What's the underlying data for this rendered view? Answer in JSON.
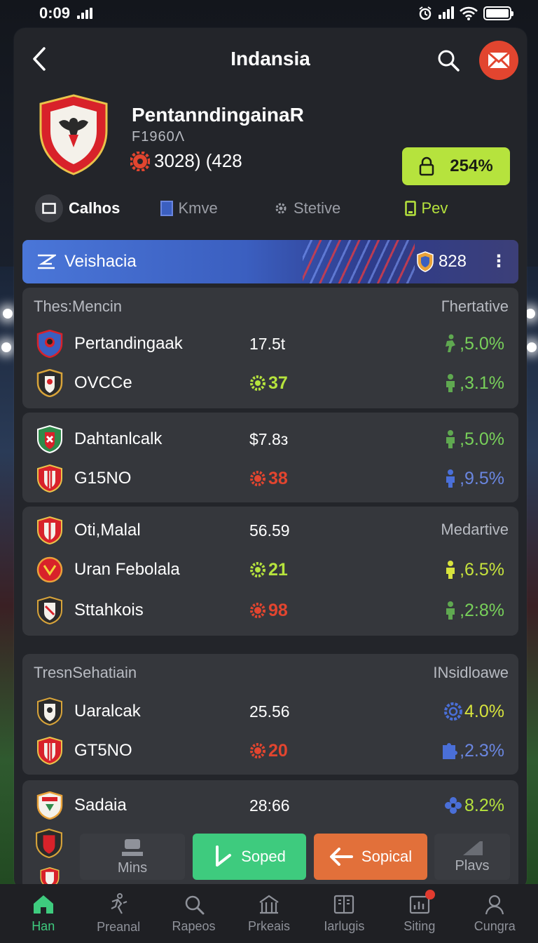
{
  "status_bar": {
    "time": "0:09"
  },
  "header": {
    "title": "Indansia"
  },
  "team": {
    "name": "PentanndingainaR",
    "subtitle": "F1960Λ",
    "score": "3028) (428",
    "percent": "254%"
  },
  "tabs": [
    {
      "label": "Calhos",
      "icon": "square-icon"
    },
    {
      "label": "Kmve",
      "icon": "card-icon"
    },
    {
      "label": "Stetive",
      "icon": "gear-icon"
    },
    {
      "label": "Pev",
      "icon": "phone-icon"
    }
  ],
  "banner": {
    "label": "Veishacia",
    "count": "828",
    "more": "⋮"
  },
  "groups": [
    {
      "left": "Thes:Mencin",
      "right": "Гhertative",
      "rows": [
        {
          "name": "Pertandingaak",
          "value": "17.5t",
          "change": ",5.0%",
          "change_color": "#78d05a",
          "icon": "runner-icon"
        },
        {
          "name": "OVCCe",
          "value": "37",
          "value_color": "#b6e33d",
          "change": ",3.1%",
          "change_color": "#78d05a",
          "icon": "person-icon"
        }
      ]
    },
    {
      "left": "",
      "right": "",
      "rows": [
        {
          "name": "Dahtanlcalk",
          "value": "$7.8з",
          "change": ",5.0%",
          "change_color": "#78d05a",
          "icon": "person-icon"
        },
        {
          "name": "G15NO",
          "value": "38",
          "value_color": "#e2452f",
          "change": ",9.5%",
          "change_color": "#6a86e0",
          "icon": "person-icon"
        }
      ]
    },
    {
      "left": "",
      "right": "Medartive",
      "rows": [
        {
          "name": "Oti,Malal",
          "value": "56.59",
          "change": "",
          "icon": ""
        },
        {
          "name": "Uran Febolala",
          "value": "21",
          "value_color": "#b6e33d",
          "change": ",6.5%",
          "change_color": "#c6e33d",
          "icon": "person-icon"
        },
        {
          "name": "Sttahkois",
          "value": "98",
          "value_color": "#e2452f",
          "change": ",2:8%",
          "change_color": "#78d05a",
          "icon": "person-icon"
        }
      ]
    },
    {
      "left": "TresnSehatiain",
      "right": "INsidloawe",
      "rows": [
        {
          "name": "Uaralcak",
          "value": "25.56",
          "change": "4.0%",
          "change_color": "#d7e33d",
          "icon": "ring-icon"
        },
        {
          "name": "GT5NO",
          "value": "20",
          "value_color": "#e2452f",
          "change": ",2.3%",
          "change_color": "#6a86e0",
          "icon": "person-icon"
        }
      ]
    },
    {
      "left": "",
      "right": "",
      "rows": [
        {
          "name": "Sadaia",
          "value": "28:66",
          "change": "8.2%",
          "change_color": "#b6e33d",
          "icon": "flower-icon"
        }
      ]
    }
  ],
  "actions": {
    "mins": "Mins",
    "soped": "Soped",
    "sopical": "Sopical",
    "plavs": "Plavs"
  },
  "nav": [
    {
      "label": "Han",
      "icon": "home-icon"
    },
    {
      "label": "Preanal",
      "icon": "runner-icon"
    },
    {
      "label": "Rapeos",
      "icon": "search-icon"
    },
    {
      "label": "Prkeais",
      "icon": "stadium-icon"
    },
    {
      "label": "Iarlugis",
      "icon": "book-icon"
    },
    {
      "label": "Siting",
      "icon": "chart-icon"
    },
    {
      "label": "Cungra",
      "icon": "profile-icon"
    }
  ],
  "colors": {
    "accent_green": "#3ecb7e",
    "lime": "#b6e33d",
    "orange": "#e2703a",
    "red": "#e2452f",
    "blue": "#4a76d8"
  }
}
